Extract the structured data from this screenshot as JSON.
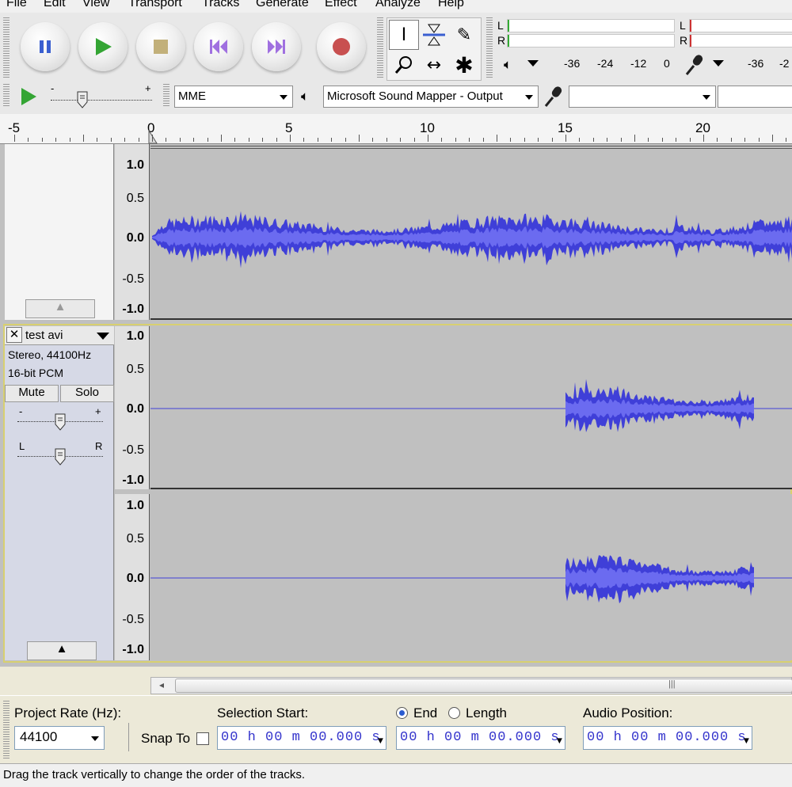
{
  "menu": {
    "items": [
      "File",
      "Edit",
      "View",
      "Transport",
      "Tracks",
      "Generate",
      "Effect",
      "Analyze",
      "Help"
    ]
  },
  "meters": {
    "playback": {
      "left": "L",
      "right": "R"
    },
    "record": {
      "left": "L",
      "right": "R"
    },
    "scale_left": [
      "-36",
      "-24",
      "-12",
      "0"
    ],
    "scale_right": [
      "-36",
      "-2"
    ]
  },
  "device": {
    "host": "MME",
    "output": "Microsoft Sound Mapper - Output",
    "input": ""
  },
  "timeline": {
    "labels": [
      "-5",
      "0",
      "5",
      "10",
      "15",
      "20"
    ]
  },
  "tracks": {
    "upper_scale": [
      "1.0",
      "0.5",
      "0.0",
      "-0.5",
      "-1.0"
    ],
    "test": {
      "name": "test avi",
      "info_rate": "Stereo, 44100Hz",
      "info_format": "16-bit PCM",
      "mute": "Mute",
      "solo": "Solo",
      "gain_minus": "-",
      "gain_plus": "+",
      "pan_left": "L",
      "pan_right": "R",
      "left_scale": [
        "1.0",
        "0.5",
        "0.0",
        "-0.5",
        "-1.0"
      ],
      "right_scale": [
        "1.0",
        "0.5",
        "0.0",
        "-0.5",
        "-1.0"
      ]
    }
  },
  "selection": {
    "project_rate_label": "Project Rate (Hz):",
    "project_rate": "44100",
    "snap_to": "Snap To",
    "selection_start_label": "Selection Start:",
    "end_label": "End",
    "length_label": "Length",
    "audio_position_label": "Audio Position:",
    "start_time": "00 h 00 m 00.000 s",
    "end_time": "00 h 00 m 00.000 s",
    "position_time": "00 h 00 m 00.000 s"
  },
  "status": "Drag the track vertically to change the order of the tracks.",
  "colors": {
    "waveform": "#3f3fd8",
    "waveform_rms": "#6b6bf0",
    "selected_border": "#e8e080",
    "record": "#c85050",
    "play": "#30a030"
  },
  "icons": [
    "pause-icon",
    "play-icon",
    "stop-icon",
    "skip-start-icon",
    "skip-end-icon",
    "record-icon",
    "selection-tool-icon",
    "envelope-tool-icon",
    "draw-tool-icon",
    "zoom-tool-icon",
    "timeshift-tool-icon",
    "multi-tool-icon",
    "speaker-icon",
    "microphone-icon",
    "close-icon",
    "dropdown-arrow-icon",
    "collapse-icon"
  ]
}
